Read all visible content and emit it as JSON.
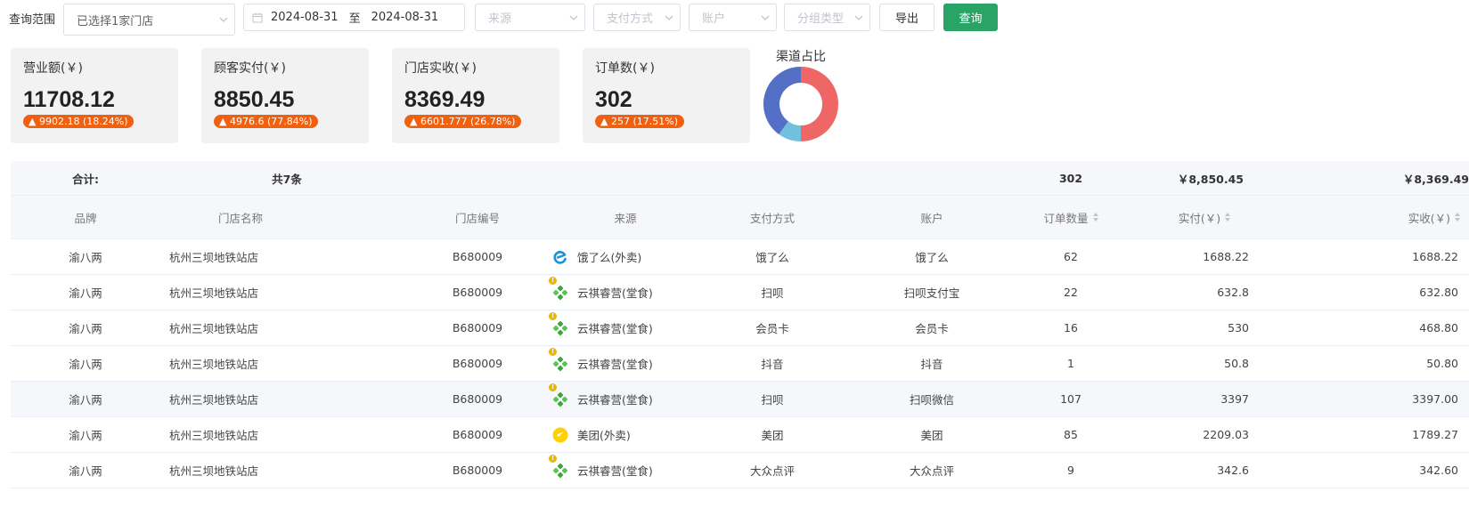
{
  "filters": {
    "range_label": "查询范围",
    "store_select": "已选择1家门店",
    "date_start": "2024-08-31",
    "date_sep": "至",
    "date_end": "2024-08-31",
    "source_placeholder": "来源",
    "pay_placeholder": "支付方式",
    "account_placeholder": "账户",
    "group_placeholder": "分组类型",
    "export_label": "导出",
    "query_label": "查询"
  },
  "cards": [
    {
      "label": "营业额(￥)",
      "value": "11708.12",
      "change": "9902.18 (18.24%)"
    },
    {
      "label": "顾客实付(￥)",
      "value": "8850.45",
      "change": "4976.6 (77.84%)"
    },
    {
      "label": "门店实收(￥)",
      "value": "8369.49",
      "change": "6601.777 (26.78%)"
    },
    {
      "label": "订单数(￥)",
      "value": "302",
      "change": "257 (17.51%)"
    }
  ],
  "channel_chart": {
    "title": "渠道占比",
    "segments_percent": [
      50,
      10,
      40
    ],
    "colors": [
      "#ee6666",
      "#73c0de",
      "#5470c6"
    ]
  },
  "colors": {
    "accent": "#2aa466",
    "badge": "#f0600f"
  },
  "summary": {
    "label": "合计:",
    "count": "共7条",
    "orders": "302",
    "paid": "￥8,850.45",
    "received": "￥8,369.49"
  },
  "columns": {
    "brand": "品牌",
    "store": "门店名称",
    "code": "门店编号",
    "source": "来源",
    "pay": "支付方式",
    "account": "账户",
    "orders": "订单数量",
    "paid": "实付(￥)",
    "received": "实收(￥)"
  },
  "rows": [
    {
      "brand": "渝八两",
      "store": "杭州三坝地铁站店",
      "code": "B680009",
      "source_icon": "eleme-icon",
      "source": "饿了么(外卖)",
      "pay": "饿了么",
      "account": "饿了么",
      "orders": "62",
      "paid": "1688.22",
      "received": "1688.22"
    },
    {
      "brand": "渝八两",
      "store": "杭州三坝地铁站店",
      "code": "B680009",
      "source_icon": "yunqi-icon",
      "source": "云祺睿营(堂食)",
      "pay": "扫呗",
      "account": "扫呗支付宝",
      "orders": "22",
      "paid": "632.8",
      "received": "632.80"
    },
    {
      "brand": "渝八两",
      "store": "杭州三坝地铁站店",
      "code": "B680009",
      "source_icon": "yunqi-icon",
      "source": "云祺睿营(堂食)",
      "pay": "会员卡",
      "account": "会员卡",
      "orders": "16",
      "paid": "530",
      "received": "468.80"
    },
    {
      "brand": "渝八两",
      "store": "杭州三坝地铁站店",
      "code": "B680009",
      "source_icon": "yunqi-icon",
      "source": "云祺睿营(堂食)",
      "pay": "抖音",
      "account": "抖音",
      "orders": "1",
      "paid": "50.8",
      "received": "50.80"
    },
    {
      "brand": "渝八两",
      "store": "杭州三坝地铁站店",
      "code": "B680009",
      "source_icon": "yunqi-icon",
      "source": "云祺睿营(堂食)",
      "pay": "扫呗",
      "account": "扫呗微信",
      "orders": "107",
      "paid": "3397",
      "received": "3397.00"
    },
    {
      "brand": "渝八两",
      "store": "杭州三坝地铁站店",
      "code": "B680009",
      "source_icon": "meituan-icon",
      "source": "美团(外卖)",
      "pay": "美团",
      "account": "美团",
      "orders": "85",
      "paid": "2209.03",
      "received": "1789.27"
    },
    {
      "brand": "渝八两",
      "store": "杭州三坝地铁站店",
      "code": "B680009",
      "source_icon": "yunqi-icon",
      "source": "云祺睿营(堂食)",
      "pay": "大众点评",
      "account": "大众点评",
      "orders": "9",
      "paid": "342.6",
      "received": "342.60"
    }
  ]
}
